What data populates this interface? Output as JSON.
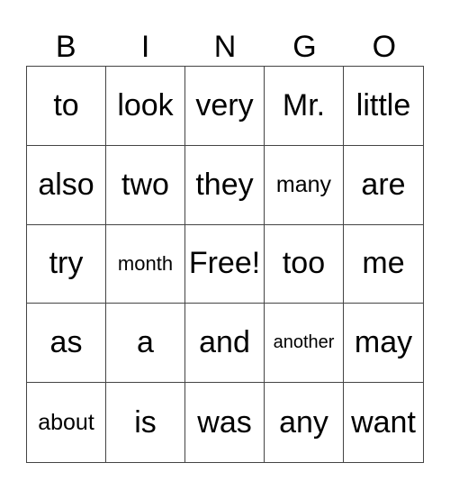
{
  "header": [
    "B",
    "I",
    "N",
    "G",
    "O"
  ],
  "cells": [
    [
      "to",
      "look",
      "very",
      "Mr.",
      "little"
    ],
    [
      "also",
      "two",
      "they",
      "many",
      "are"
    ],
    [
      "try",
      "month",
      "Free!",
      "too",
      "me"
    ],
    [
      "as",
      "a",
      "and",
      "another",
      "may"
    ],
    [
      "about",
      "is",
      "was",
      "any",
      "want"
    ]
  ]
}
